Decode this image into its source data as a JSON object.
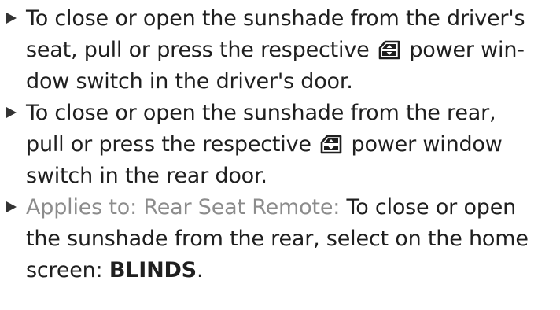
{
  "items": [
    {
      "lines": [
        "To close or open the sunshade from the driver's",
        "seat, pull or press the respective",
        "power win-",
        "dow switch in the driver's door."
      ],
      "icon": "power-window-switch-icon"
    },
    {
      "lines": [
        "To close or open the sunshade from the rear,",
        "pull or press the respective",
        "power window",
        "switch in the rear door."
      ],
      "icon": "power-window-switch-icon"
    },
    {
      "prefix": "Applies to: Rear Seat Remote:",
      "lines": [
        "To close or open",
        "the sunshade from the rear, select on the home",
        "screen:",
        "BLINDS",
        "."
      ]
    }
  ],
  "colors": {
    "text": "#1f1f1f",
    "applies_to": "#8c8c8c",
    "bullet": "#333333"
  }
}
